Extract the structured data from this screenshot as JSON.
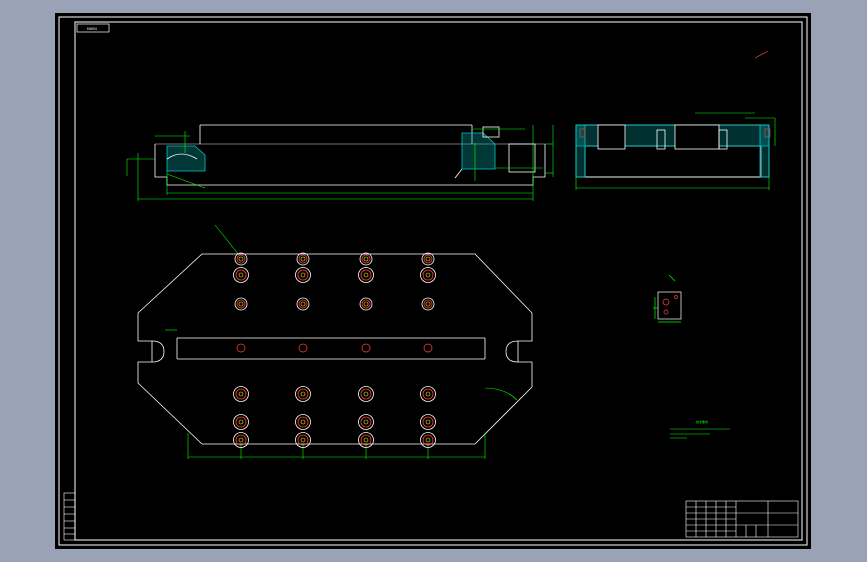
{
  "sheet": {
    "drawing_number_tag": "MW04",
    "colors": {
      "background_outside": "#9aa3b6",
      "sheet": "#000000",
      "outline": "#ffffff",
      "dimension": "#00ff00",
      "hatch": "#00c8c8",
      "hole_outer": "#ff3b3b",
      "hole_inner": "#ffff00",
      "center_mark": "#ff5050"
    }
  },
  "views": {
    "front_section": {
      "name": "front-section-view"
    },
    "side_section": {
      "name": "side-section-view"
    },
    "plan": {
      "name": "plan-view"
    },
    "detail": {
      "name": "detail-view"
    }
  },
  "notes": {
    "title": "技术要求",
    "lines": [
      "1.",
      "2."
    ]
  },
  "title_block": {
    "drawing_title": "",
    "code": "",
    "scale": "",
    "sheet_no": ""
  }
}
